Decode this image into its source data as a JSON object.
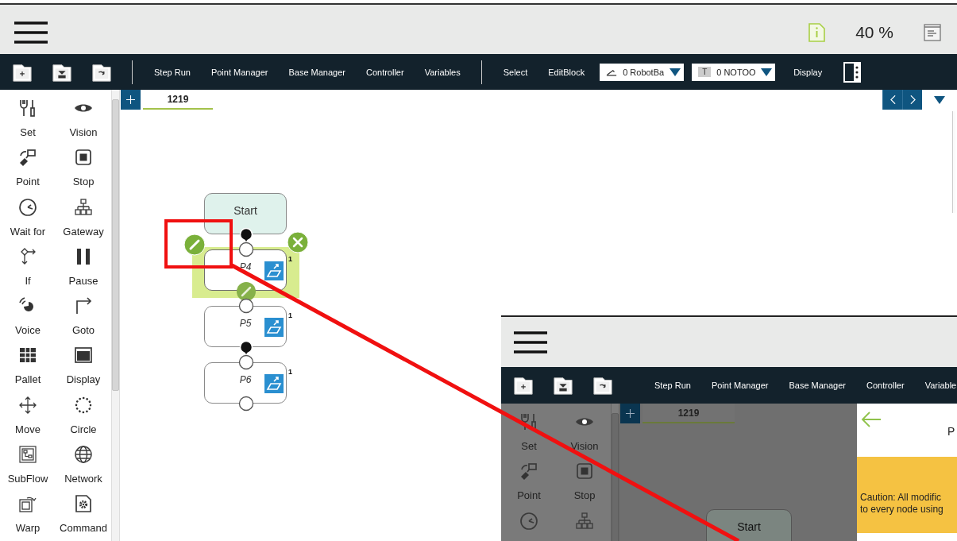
{
  "topbar": {
    "zoom": "40 %"
  },
  "toolbar": {
    "items": [
      "Step Run",
      "Point Manager",
      "Base Manager",
      "Controller",
      "Variables"
    ],
    "items2": [
      "Select",
      "EditBlock"
    ],
    "base_dropdown": "0 RobotBa",
    "tool_dropdown": {
      "badge": "T",
      "value": "0 NOTOO"
    },
    "display": "Display"
  },
  "palette": [
    "Set",
    "Vision",
    "Point",
    "Stop",
    "Wait for",
    "Gateway",
    "If",
    "Pause",
    "Voice",
    "Goto",
    "Pallet",
    "Display",
    "Move",
    "Circle",
    "SubFlow",
    "Network",
    "Warp",
    "Command"
  ],
  "tabs": [
    {
      "label": "1219",
      "selected": true
    }
  ],
  "flow": {
    "nodes": [
      {
        "kind": "start",
        "label": "Start",
        "selected": false
      },
      {
        "kind": "point",
        "label": "P4",
        "count": "1",
        "selected": true
      },
      {
        "kind": "point",
        "label": "P5",
        "count": "1",
        "selected": false
      },
      {
        "kind": "point",
        "label": "P6",
        "count": "1",
        "selected": false
      }
    ]
  },
  "inset": {
    "toolbar": [
      "Step Run",
      "Point Manager",
      "Base Manager",
      "Controller",
      "Variable"
    ],
    "palette": [
      "Set",
      "Vision",
      "Point",
      "Stop"
    ],
    "tab": "1219",
    "start_node": "Start",
    "panel_title": "P",
    "caution": [
      "Caution: All modific",
      "to every node using"
    ]
  }
}
